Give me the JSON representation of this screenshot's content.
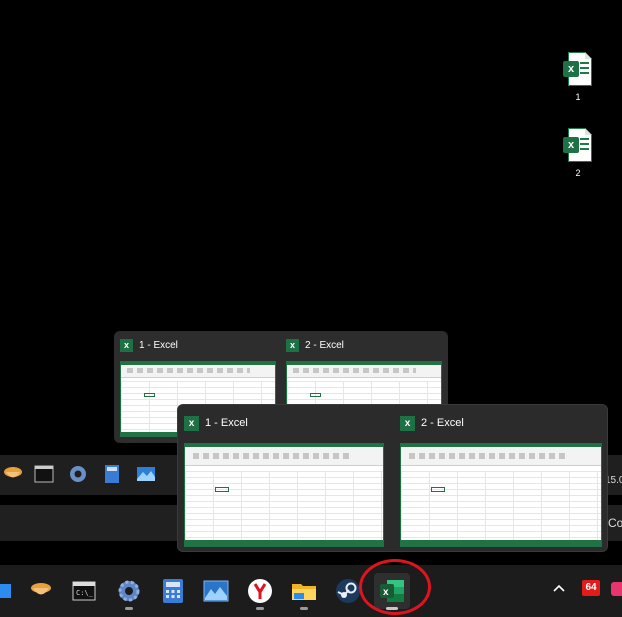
{
  "desktop": {
    "icons": [
      {
        "label": "1",
        "icon": "excel-file-icon"
      },
      {
        "label": "2",
        "icon": "excel-file-icon"
      }
    ]
  },
  "previews": {
    "back": [
      {
        "title": "1 - Excel"
      },
      {
        "title": "2 - Excel"
      }
    ],
    "front": [
      {
        "title": "1 - Excel"
      },
      {
        "title": "2 - Excel"
      }
    ]
  },
  "strip": {
    "right_text_top": "15.0",
    "right_text_bottom": "Co"
  },
  "taskbar": {
    "items": [
      "explorer-icon",
      "sticky-app-icon",
      "terminal-icon",
      "settings-icon",
      "calculator-icon",
      "photos-icon",
      "yandex-browser-icon",
      "file-explorer-icon",
      "steam-icon",
      "excel-icon"
    ],
    "active": "excel-icon",
    "tray_badge": "64"
  },
  "colors": {
    "excel_green": "#1e7145",
    "annotation_red": "#e0141e"
  }
}
